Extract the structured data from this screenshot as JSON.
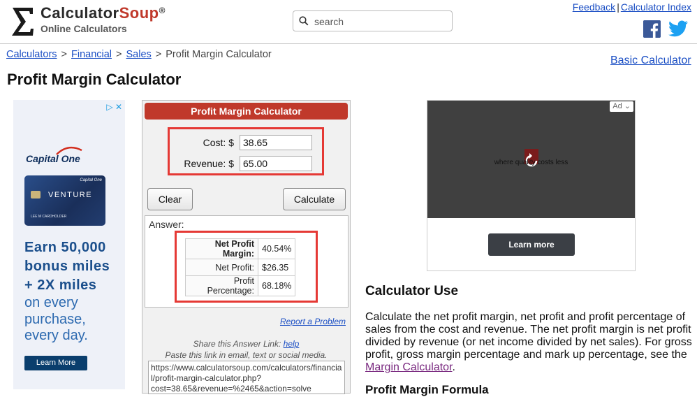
{
  "header": {
    "logo_sigma": "Σ",
    "logo_calculator": "Calculator",
    "logo_soup": "Soup",
    "logo_reg": "®",
    "logo_sub": "Online Calculators",
    "search_placeholder": "search",
    "feedback_link": "Feedback",
    "separator": "|",
    "index_link": "Calculator Index"
  },
  "breadcrumb": {
    "items": [
      "Calculators",
      "Financial",
      "Sales"
    ],
    "current": "Profit Margin Calculator",
    "arrow": ">"
  },
  "basic_calculator_link": "Basic Calculator",
  "page_title": "Profit Margin Calculator",
  "left_ad": {
    "brand": "Capital One",
    "card_brand": "Capital One",
    "card_name": "VENTURE",
    "card_holder": "LEE M CARDHOLDER",
    "headline_lines": [
      "Earn 50,000",
      "bonus miles",
      "+ 2X miles"
    ],
    "body_lines": [
      "on every",
      "purchase,",
      "every day."
    ],
    "button_label": "Learn More"
  },
  "calculator": {
    "title": "Profit Margin Calculator",
    "cost_label": "Cost: $",
    "cost_value": "38.65",
    "revenue_label": "Revenue: $",
    "revenue_value": "65.00",
    "clear_label": "Clear",
    "calculate_label": "Calculate",
    "answer_label": "Answer:",
    "results": [
      {
        "label": "Net Profit Margin:",
        "value": "40.54%"
      },
      {
        "label": "Net Profit:",
        "value": "$26.35"
      },
      {
        "label": "Profit Percentage:",
        "value": "68.18%"
      }
    ],
    "report_link": "Report a Problem",
    "share_text": "Share this Answer Link:",
    "share_help": "help",
    "paste_text": "Paste this link in email, text or social media.",
    "share_url": "https://www.calculatorsoup.com/calculators/financial/profit-margin-calculator.php?cost=38.65&revenue=%2465&action=solve"
  },
  "right_ad": {
    "badge": "Ad",
    "tagline": "where quality costs less",
    "button_label": "Learn more"
  },
  "calculator_use": {
    "title": "Calculator Use",
    "text": "Calculate the net profit margin, net profit and profit percentage of sales from the cost and revenue. The net profit margin is net profit divided by revenue (or net income divided by net sales). For gross profit, gross margin percentage and mark up percentage, see the ",
    "link": "Margin Calculator",
    "after": ".",
    "next_heading": "Profit Margin Formula"
  },
  "colors": {
    "brand_red": "#c0392b",
    "highlight_red": "#e53935",
    "link_blue": "#1a4ec4",
    "facebook": "#3b5998",
    "twitter": "#1da1f2"
  }
}
